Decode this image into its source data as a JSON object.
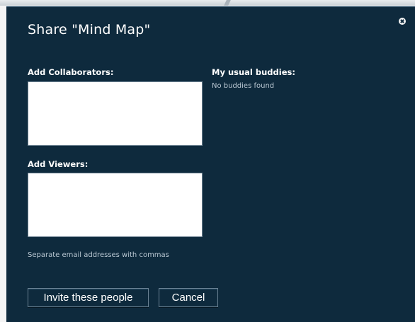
{
  "dialog": {
    "title": "Share \"Mind Map\"",
    "close_icon": "close-icon"
  },
  "collaborators": {
    "label": "Add Collaborators:",
    "value": ""
  },
  "viewers": {
    "label": "Add Viewers:",
    "value": ""
  },
  "hint": "Separate email addresses with commas",
  "buddies": {
    "label": "My usual buddies:",
    "empty_text": "No buddies found"
  },
  "buttons": {
    "invite_label": "Invite these people",
    "cancel_label": "Cancel"
  },
  "colors": {
    "dialog_background": "#0e2a3d",
    "text": "#ffffff",
    "muted_text": "#b9c7d2"
  }
}
